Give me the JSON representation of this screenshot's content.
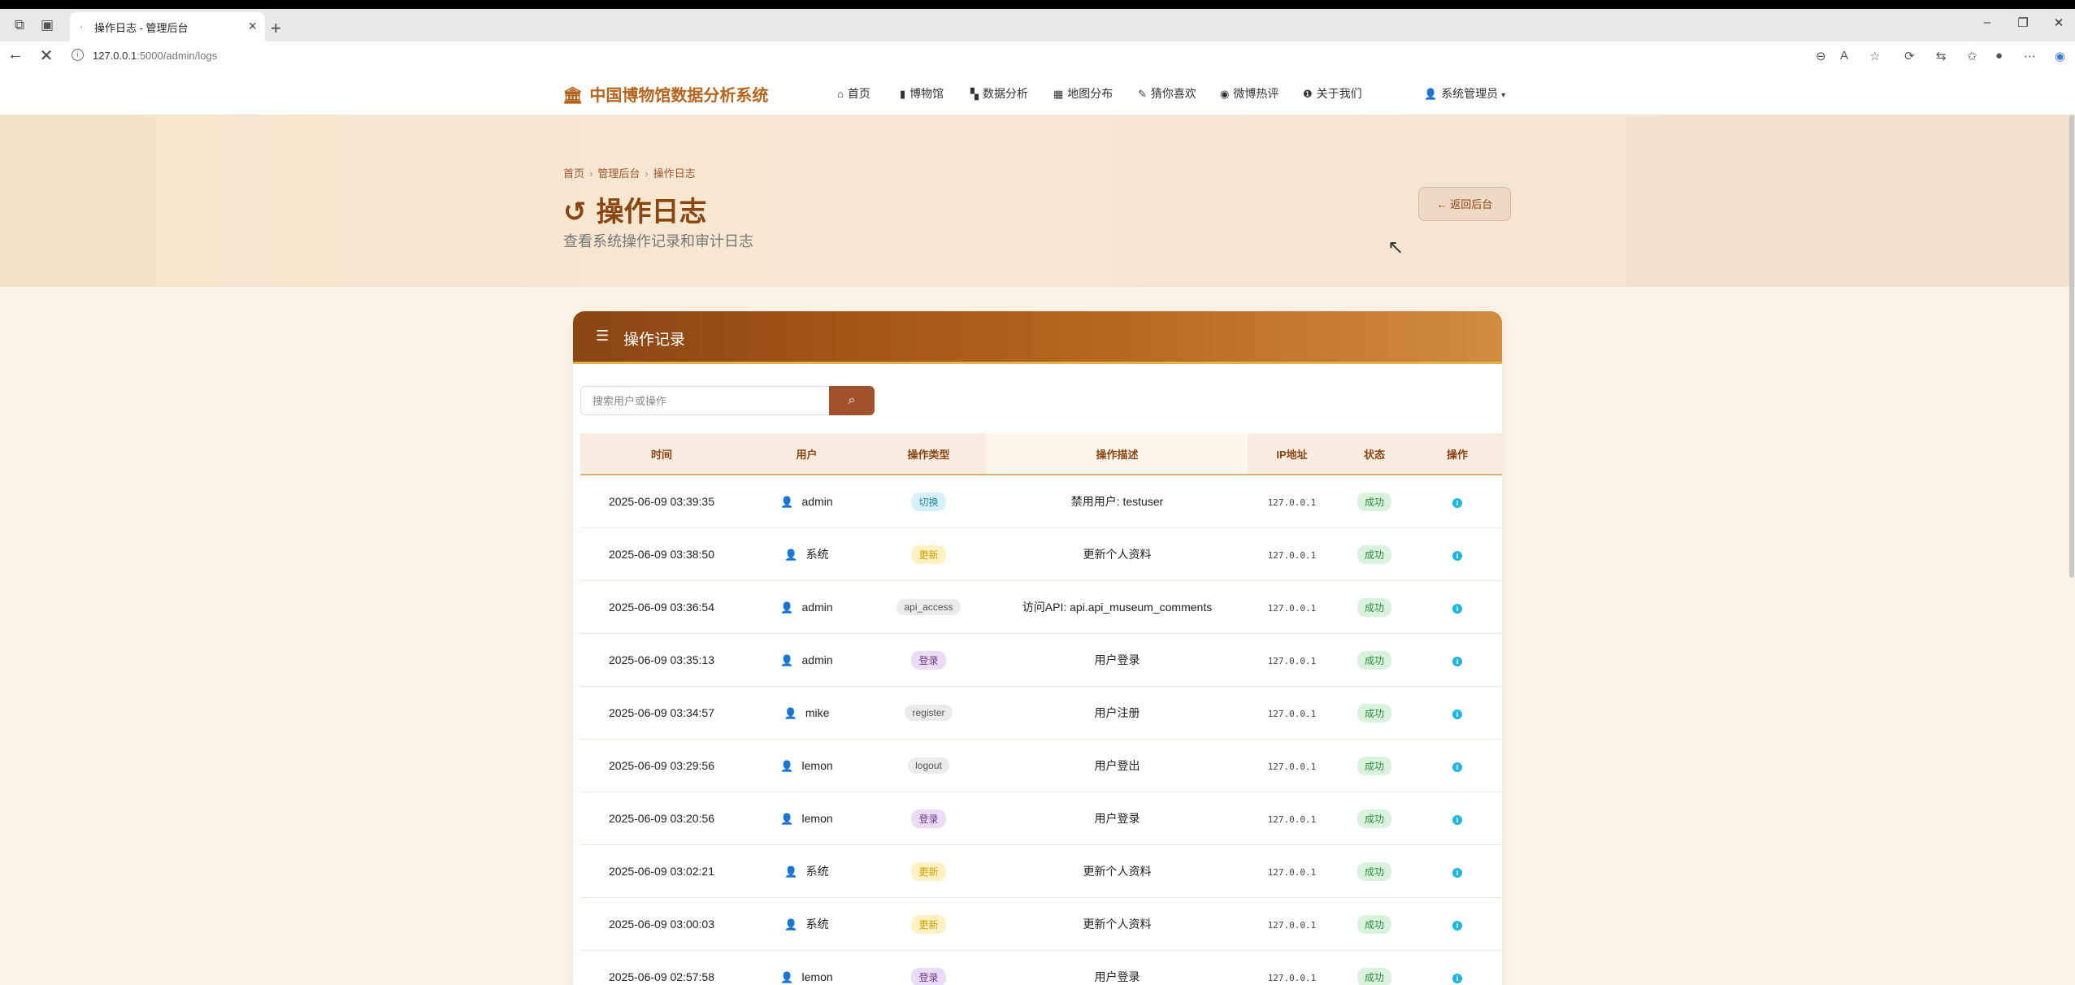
{
  "browser": {
    "tab_title": "操作日志 - 管理后台",
    "url_host": "127.0.0.1",
    "url_rest": ":5000/admin/logs"
  },
  "site": {
    "brand": "中国博物馆数据分析系统",
    "menu": [
      {
        "label": "首页",
        "icon": "home-icon"
      },
      {
        "label": "博物馆",
        "icon": "bookmark-icon"
      },
      {
        "label": "数据分析",
        "icon": "chart-icon"
      },
      {
        "label": "地图分布",
        "icon": "map-icon"
      },
      {
        "label": "猜你喜欢",
        "icon": "pen-icon"
      },
      {
        "label": "微博热评",
        "icon": "weibo-icon"
      },
      {
        "label": "关于我们",
        "icon": "info-icon"
      }
    ],
    "user_menu": "系统管理员"
  },
  "hero": {
    "breadcrumb": [
      "首页",
      "管理后台",
      "操作日志"
    ],
    "title": "操作日志",
    "subtitle": "查看系统操作记录和审计日志",
    "back_button": "返回后台"
  },
  "card": {
    "title": "操作记录",
    "search_placeholder": "搜索用户或操作",
    "columns": [
      "时间",
      "用户",
      "操作类型",
      "操作描述",
      "IP地址",
      "状态",
      "操作"
    ],
    "rows": [
      {
        "time": "2025-06-09 03:39:35",
        "user": "admin",
        "type": "切换",
        "type_style": "switch",
        "desc": "禁用用户: testuser",
        "ip": "127.0.0.1",
        "status": "成功"
      },
      {
        "time": "2025-06-09 03:38:50",
        "user": "系统",
        "type": "更新",
        "type_style": "update",
        "desc": "更新个人资料",
        "ip": "127.0.0.1",
        "status": "成功"
      },
      {
        "time": "2025-06-09 03:36:54",
        "user": "admin",
        "type": "api_access",
        "type_style": "gray",
        "desc": "访问API: api.api_museum_comments",
        "ip": "127.0.0.1",
        "status": "成功"
      },
      {
        "time": "2025-06-09 03:35:13",
        "user": "admin",
        "type": "登录",
        "type_style": "login",
        "desc": "用户登录",
        "ip": "127.0.0.1",
        "status": "成功"
      },
      {
        "time": "2025-06-09 03:34:57",
        "user": "mike",
        "type": "register",
        "type_style": "gray",
        "desc": "用户注册",
        "ip": "127.0.0.1",
        "status": "成功"
      },
      {
        "time": "2025-06-09 03:29:56",
        "user": "lemon",
        "type": "logout",
        "type_style": "gray",
        "desc": "用户登出",
        "ip": "127.0.0.1",
        "status": "成功"
      },
      {
        "time": "2025-06-09 03:20:56",
        "user": "lemon",
        "type": "登录",
        "type_style": "login",
        "desc": "用户登录",
        "ip": "127.0.0.1",
        "status": "成功"
      },
      {
        "time": "2025-06-09 03:02:21",
        "user": "系统",
        "type": "更新",
        "type_style": "update",
        "desc": "更新个人资料",
        "ip": "127.0.0.1",
        "status": "成功"
      },
      {
        "time": "2025-06-09 03:00:03",
        "user": "系统",
        "type": "更新",
        "type_style": "update",
        "desc": "更新个人资料",
        "ip": "127.0.0.1",
        "status": "成功"
      },
      {
        "time": "2025-06-09 02:57:58",
        "user": "lemon",
        "type": "登录",
        "type_style": "login",
        "desc": "用户登录",
        "ip": "127.0.0.1",
        "status": "成功"
      }
    ]
  },
  "colors": {
    "accent": "#b5651d",
    "dark_accent": "#8b4513",
    "info": "#1fb6e0",
    "success": "#2e8b3e"
  }
}
